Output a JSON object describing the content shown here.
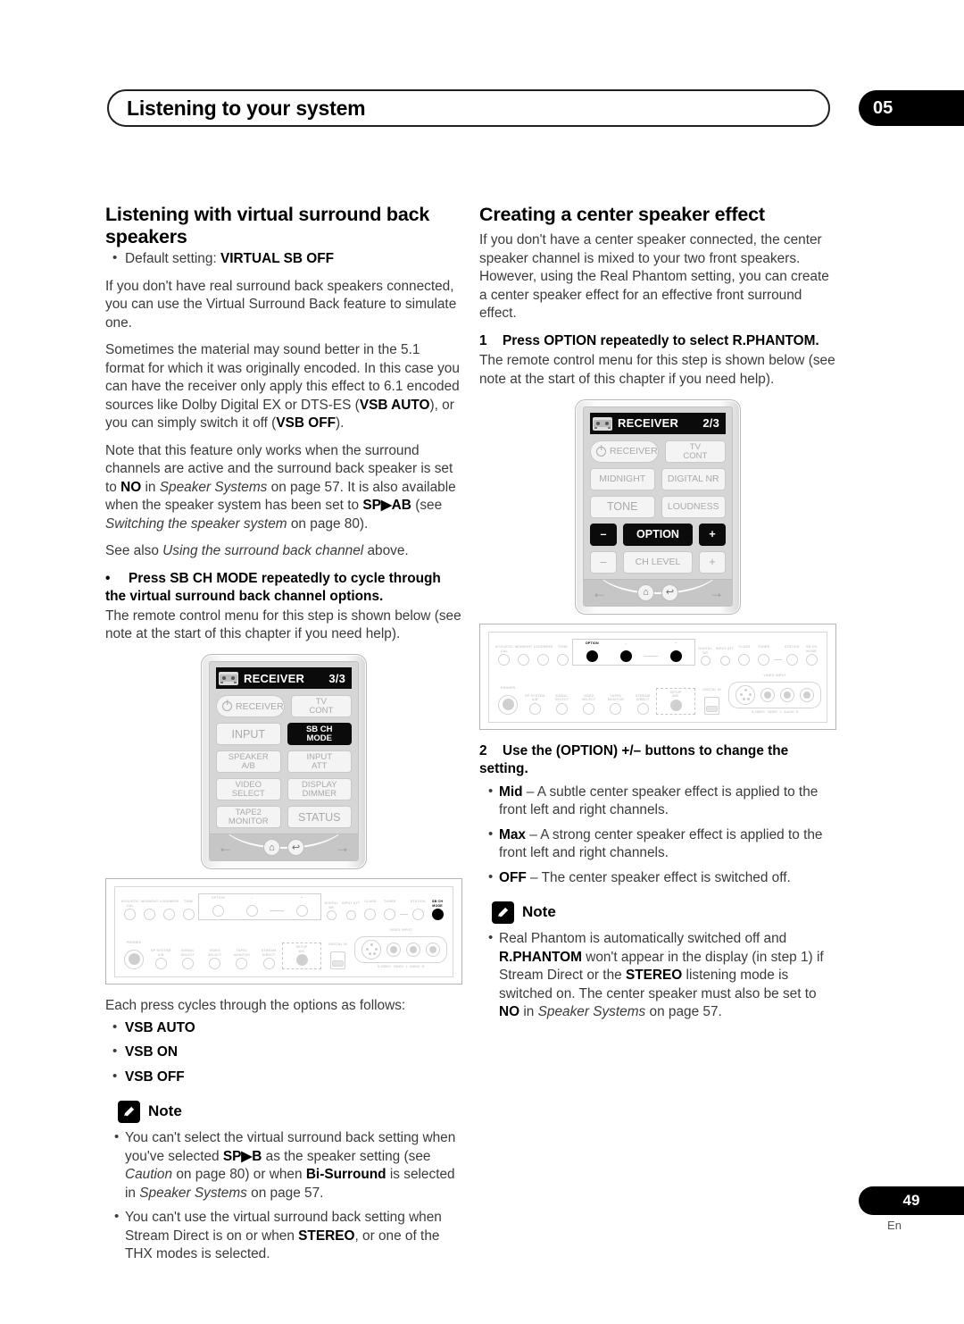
{
  "header": {
    "title": "Listening to your system",
    "chapter": "05"
  },
  "footer": {
    "page_number": "49",
    "language": "En"
  },
  "left_column": {
    "section_title": "Listening with virtual surround back speakers",
    "default_setting_label": "Default setting:",
    "default_setting_value": "VIRTUAL SB OFF",
    "para1": "If you don't have real surround back speakers connected, you can use the Virtual Surround Back feature to simulate one.",
    "para2_a": "Sometimes the material may sound better in the 5.1 format for which it was originally encoded. In this case you can have the receiver only apply this effect to 6.1 encoded sources like Dolby Digital EX or DTS-ES (",
    "para2_b": "VSB AUTO",
    "para2_c": "), or you can simply switch it off (",
    "para2_d": "VSB OFF",
    "para2_e": ").",
    "para3_a": "Note that this feature only works when the surround channels are active and the surround back speaker is set to ",
    "para3_no": "NO",
    "para3_b": " in ",
    "para3_it1": "Speaker Systems",
    "para3_c": " on page 57. It is also available when the speaker system has been set to ",
    "para3_sp": "SP▶AB",
    "para3_d": " (see ",
    "para3_it2": "Switching the speaker system",
    "para3_e": " on page 80).",
    "para4_a": "See also ",
    "para4_it": "Using the surround back channel",
    "para4_b": " above.",
    "instruction": "Press SB CH MODE repeatedly to cycle through the virtual surround back channel options.",
    "instruction_follow": "The remote control menu for this step is shown below (see note at the start of this chapter if you need help).",
    "cycle_intro": "Each press cycles through the options as follows:",
    "cycle_options": [
      "VSB AUTO",
      "VSB ON",
      "VSB OFF"
    ],
    "note_label": "Note",
    "note_items": [
      {
        "a": "You can't select the virtual surround back setting when you've selected ",
        "b1": "SP▶B",
        "c": " as the speaker setting (see ",
        "it1": "Caution",
        "d": " on page 80) or when ",
        "b2": "Bi-Surround",
        "e": " is selected in ",
        "it2": "Speaker Systems",
        "f": " on page 57."
      },
      {
        "a": "You can't use the virtual surround back setting when Stream Direct is on or when ",
        "b1": "STEREO",
        "c": ", or one of the THX modes is selected."
      }
    ],
    "remote": {
      "screen_title": "RECEIVER",
      "screen_page": "3/3",
      "buttons": [
        {
          "label": "RECEIVER",
          "style": "pill",
          "power": true
        },
        {
          "label": "TV\nCONT"
        },
        {
          "label": "INPUT",
          "style": "big"
        },
        {
          "label": "SB CH\nMODE",
          "highlight": true
        },
        {
          "label": "SPEAKER\nA/B"
        },
        {
          "label": "INPUT\nATT"
        },
        {
          "label": "VIDEO\nSELECT"
        },
        {
          "label": "DISPLAY\nDIMMER"
        },
        {
          "label": "TAPE2\nMONITOR"
        },
        {
          "label": "STATUS",
          "style": "big"
        }
      ],
      "foot": {
        "left_arrow": "←",
        "right_arrow": "→",
        "home_icon": "⌂",
        "back_icon": "↩"
      }
    },
    "panel": {
      "top_labels": [
        "ACOUSTIC\nCAL",
        "MIDNIGHT",
        "LOUDNESS",
        "TONE",
        "OPTION",
        "–",
        "+",
        "DIGITAL NR",
        "INPUT ATT",
        "CLASS",
        "–",
        "+",
        "SB CH\nMODE"
      ],
      "tuner_label": "TUNER",
      "station_label": "STATION",
      "bottom_labels": [
        "PHONES",
        "SP SYSTEM\nA/B",
        "SIGNAL\nSELECT",
        "VIDEO\nSELECT",
        "TAPE2\nMONITOR",
        "STREAM\nDIRECT",
        "SETUP\nMIC",
        "DIGITAL IN"
      ],
      "video_input_label": "VIDEO INPUT",
      "jack_labels": [
        "S-VIDEO",
        "VIDEO",
        "L",
        "AUDIO",
        "R"
      ],
      "highlight": "SB CH MODE"
    }
  },
  "right_column": {
    "section_title": "Creating a center speaker effect",
    "para1": "If you don't have a center speaker connected, the center speaker channel is mixed to your two front speakers. However, using the Real Phantom setting, you can create a center speaker effect for an effective front surround effect.",
    "step1_num": "1",
    "step1_text": "Press OPTION repeatedly to select R.PHANTOM.",
    "step1_follow": "The remote control menu for this step is shown below (see note at the start of this chapter if you need help).",
    "step2_num": "2",
    "step2_text": "Use the (OPTION) +/– buttons to change the setting.",
    "step2_items": [
      {
        "term": "Mid",
        "desc": " – A subtle center speaker effect is applied to the front left and right channels."
      },
      {
        "term": "Max",
        "desc": " – A strong center speaker effect is applied to the front left and right channels."
      },
      {
        "term": "OFF",
        "desc": " – The center speaker effect is switched off."
      }
    ],
    "note_label": "Note",
    "note_items": [
      {
        "a": "Real Phantom is automatically switched off and ",
        "b1": "R.PHANTOM",
        "c": " won't appear in the display (in step 1) if Stream Direct or the ",
        "b2": "STEREO",
        "d": " listening mode is switched on. The center speaker must also be set to ",
        "b3": "NO",
        "e": " in ",
        "it1": "Speaker Systems",
        "f": " on page 57."
      }
    ],
    "remote": {
      "screen_title": "RECEIVER",
      "screen_page": "2/3",
      "buttons": [
        {
          "label": "RECEIVER",
          "style": "pill",
          "power": true
        },
        {
          "label": "TV\nCONT"
        },
        {
          "label": "MIDNIGHT"
        },
        {
          "label": "DIGITAL NR"
        },
        {
          "label": "TONE",
          "style": "big"
        },
        {
          "label": "LOUDNESS"
        },
        {
          "label": "–",
          "highlight": true
        },
        {
          "label": "OPTION",
          "highlight": true
        },
        {
          "label": "+",
          "highlight": true
        },
        {
          "label": "–"
        },
        {
          "label": "CH LEVEL"
        },
        {
          "label": "+"
        }
      ],
      "foot": {
        "left_arrow": "←",
        "right_arrow": "→",
        "home_icon": "⌂",
        "back_icon": "↩"
      }
    },
    "panel": {
      "top_labels": [
        "ACOUSTIC\nCAL",
        "MIDNIGHT",
        "LOUDNESS",
        "TONE",
        "OPTION",
        "–",
        "+",
        "DIGITAL NR",
        "INPUT ATT",
        "CLASS",
        "–",
        "+",
        "SB CH\nMODE"
      ],
      "tuner_label": "TUNER",
      "station_label": "STATION",
      "bottom_labels": [
        "PHONES",
        "SP SYSTEM\nA/B",
        "SIGNAL\nSELECT",
        "VIDEO\nSELECT",
        "TAPE2\nMONITOR",
        "STREAM\nDIRECT",
        "SETUP\nMIC",
        "DIGITAL IN"
      ],
      "video_input_label": "VIDEO INPUT",
      "jack_labels": [
        "S-VIDEO",
        "VIDEO",
        "L",
        "AUDIO",
        "R"
      ],
      "highlight": "OPTION +/-"
    }
  }
}
